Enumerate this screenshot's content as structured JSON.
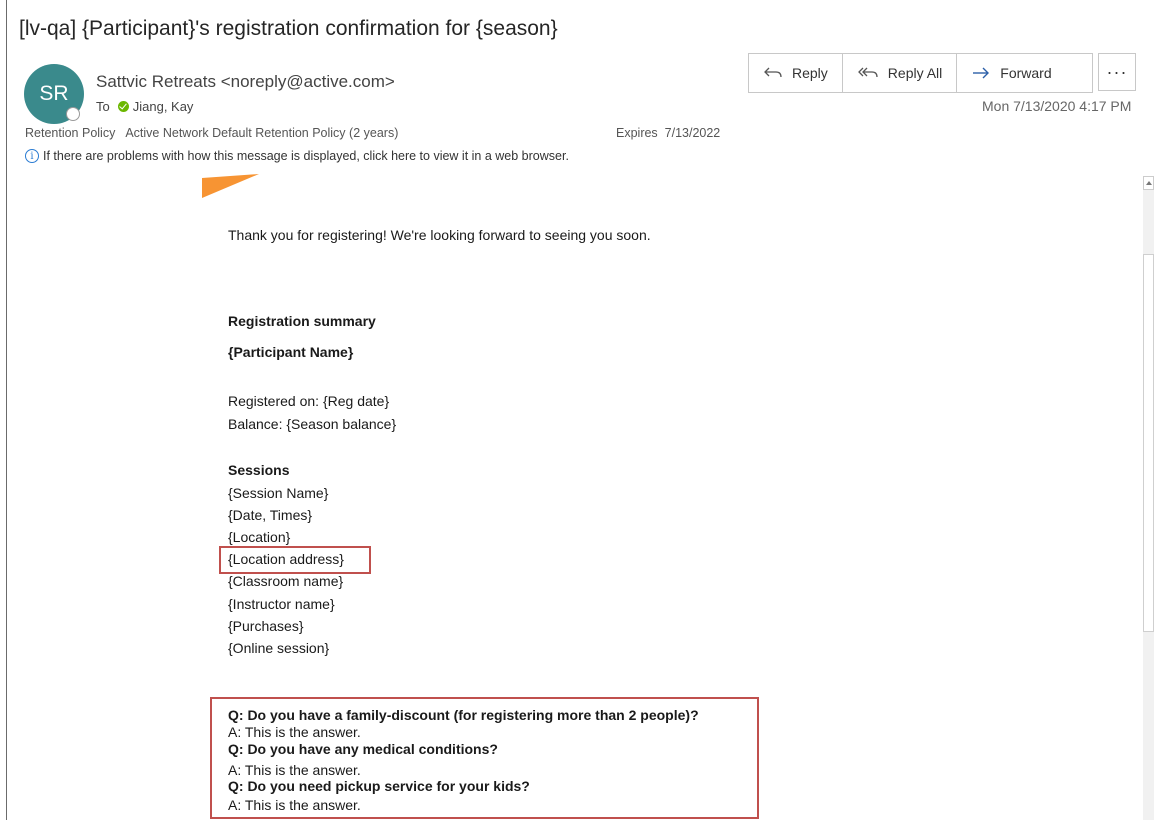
{
  "email": {
    "subject": "[lv-qa] {Participant}'s registration confirmation for {season}",
    "avatar_initials": "SR",
    "sender": "Sattvic Retreats <noreply@active.com>",
    "to_label": "To",
    "recipient": "Jiang, Kay",
    "date": "Mon 7/13/2020 4:17 PM",
    "retention_label": "Retention Policy",
    "retention_value": "Active Network Default Retention Policy (2 years)",
    "expires_label": "Expires",
    "expires_value": "7/13/2022",
    "info_bar": "If there are problems with how this message is displayed, click here to view it in a web browser."
  },
  "actions": {
    "reply": "Reply",
    "reply_all": "Reply All",
    "forward": "Forward",
    "more": "···"
  },
  "message": {
    "greeting": "Thank you for registering! We're looking forward to seeing you soon.",
    "summary_heading": "Registration summary",
    "participant_name": "{Participant Name}",
    "registered_on": "Registered on: {Reg date}",
    "balance": "Balance: {Season balance}",
    "sessions_heading": "Sessions",
    "sessions": [
      "{Session Name}",
      "{Date, Times}",
      "{Location}",
      "{Location address}",
      "{Classroom name}",
      "{Instructor name}",
      "{Purchases}",
      "{Online session}"
    ],
    "qa": [
      {
        "q": "Q: Do you have a family-discount (for registering more than 2 people)?",
        "a": "A: This is the answer."
      },
      {
        "q": "Q: Do you have any medical conditions?",
        "a": "A: This is the answer."
      },
      {
        "q": "Q: Do you need pickup service for your kids?",
        "a": "A: This is the answer."
      }
    ]
  },
  "colors": {
    "avatar": "#3a8a8c",
    "highlight_box": "#c0504d",
    "banner_orange": "#f79433",
    "info_icon": "#2b7cd3"
  }
}
